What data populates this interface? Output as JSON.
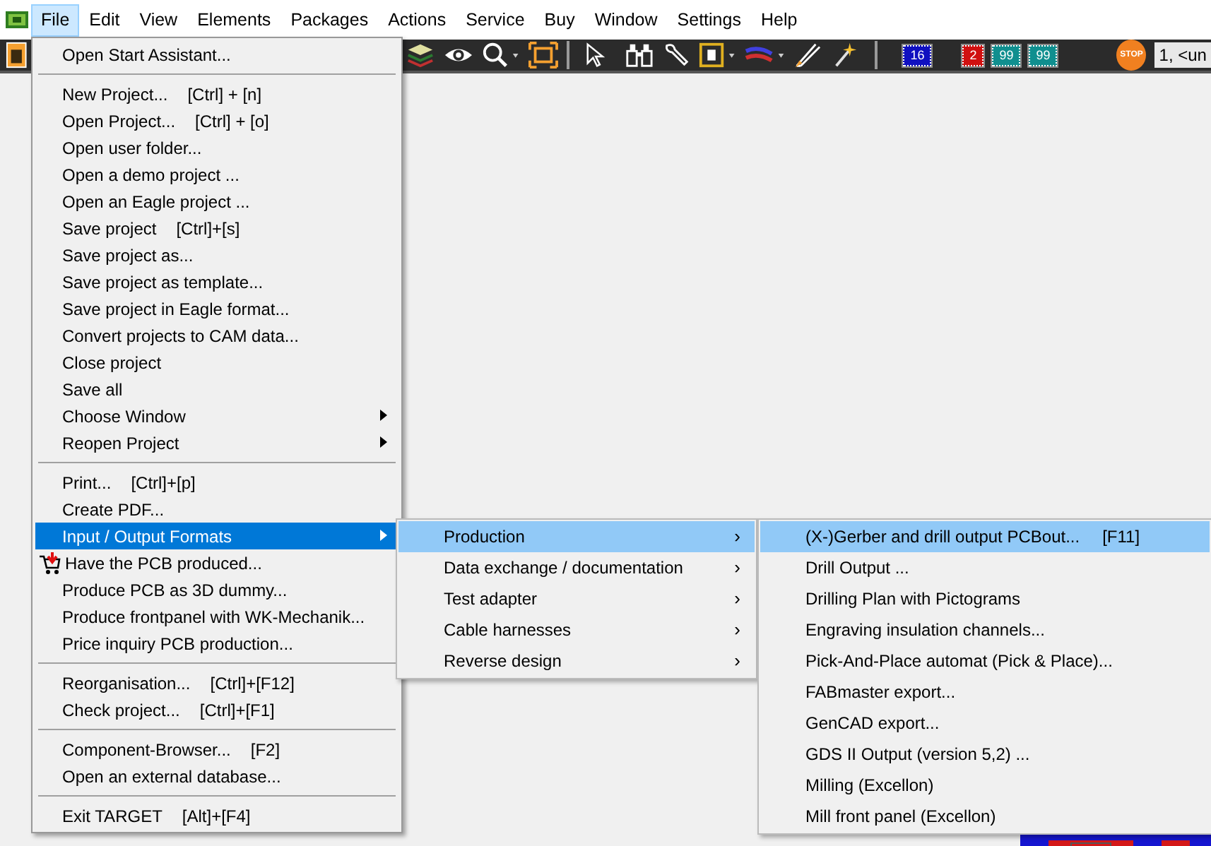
{
  "menubar": [
    {
      "label": "File",
      "selected": true
    },
    {
      "label": "Edit",
      "selected": false
    },
    {
      "label": "View",
      "selected": false
    },
    {
      "label": "Elements",
      "selected": false
    },
    {
      "label": "Packages",
      "selected": false
    },
    {
      "label": "Actions",
      "selected": false
    },
    {
      "label": "Service",
      "selected": false
    },
    {
      "label": "Buy",
      "selected": false
    },
    {
      "label": "Window",
      "selected": false
    },
    {
      "label": "Settings",
      "selected": false
    },
    {
      "label": "Help",
      "selected": false
    }
  ],
  "toolbar": {
    "badges": [
      {
        "label": "16",
        "color": "#1010c0"
      },
      {
        "label": "2",
        "color": "#d01010"
      },
      {
        "label": "99",
        "color": "#108f8f"
      },
      {
        "label": "99",
        "color": "#108f8f"
      }
    ],
    "stop_label": "STOP",
    "layer_field": "1, <un"
  },
  "file_menu": [
    {
      "kind": "item",
      "label": "Open Start Assistant...",
      "submenu": false,
      "selected": false
    },
    {
      "kind": "separator"
    },
    {
      "kind": "item",
      "label": "New Project...",
      "shortcut": "[Ctrl] + [n]",
      "submenu": false,
      "selected": false
    },
    {
      "kind": "item",
      "label": "Open Project...",
      "shortcut": "[Ctrl] + [o]",
      "submenu": false,
      "selected": false
    },
    {
      "kind": "item",
      "label": "Open user folder...",
      "submenu": false,
      "selected": false
    },
    {
      "kind": "item",
      "label": "Open a demo project ...",
      "submenu": false,
      "selected": false
    },
    {
      "kind": "item",
      "label": "Open an Eagle project ...",
      "submenu": false,
      "selected": false
    },
    {
      "kind": "item",
      "label": "Save project",
      "shortcut": "[Ctrl]+[s]",
      "submenu": false,
      "selected": false
    },
    {
      "kind": "item",
      "label": "Save project as...",
      "submenu": false,
      "selected": false
    },
    {
      "kind": "item",
      "label": "Save project as template...",
      "submenu": false,
      "selected": false
    },
    {
      "kind": "item",
      "label": "Save project in Eagle format...",
      "submenu": false,
      "selected": false
    },
    {
      "kind": "item",
      "label": "Convert projects to CAM data...",
      "submenu": false,
      "selected": false
    },
    {
      "kind": "item",
      "label": "Close project",
      "submenu": false,
      "selected": false
    },
    {
      "kind": "item",
      "label": "Save all",
      "submenu": false,
      "selected": false
    },
    {
      "kind": "item",
      "label": "Choose Window",
      "submenu": true,
      "selected": false
    },
    {
      "kind": "item",
      "label": "Reopen Project",
      "submenu": true,
      "selected": false
    },
    {
      "kind": "separator"
    },
    {
      "kind": "item",
      "label": "Print...",
      "shortcut": "[Ctrl]+[p]",
      "submenu": false,
      "selected": false
    },
    {
      "kind": "item",
      "label": "Create PDF...",
      "submenu": false,
      "selected": false
    },
    {
      "kind": "item",
      "label": "Input / Output Formats",
      "submenu": true,
      "selected": true
    },
    {
      "kind": "icon-item",
      "label": "Have the PCB produced...",
      "submenu": false,
      "selected": false
    },
    {
      "kind": "item",
      "label": "Produce PCB as 3D dummy...",
      "submenu": false,
      "selected": false
    },
    {
      "kind": "item",
      "label": "Produce frontpanel with WK-Mechanik...",
      "submenu": false,
      "selected": false
    },
    {
      "kind": "item",
      "label": "Price inquiry PCB production...",
      "submenu": false,
      "selected": false
    },
    {
      "kind": "separator"
    },
    {
      "kind": "item",
      "label": "Reorganisation...",
      "shortcut": "[Ctrl]+[F12]",
      "submenu": false,
      "selected": false
    },
    {
      "kind": "item",
      "label": "Check project...",
      "shortcut": "[Ctrl]+[F1]",
      "submenu": false,
      "selected": false
    },
    {
      "kind": "separator"
    },
    {
      "kind": "item",
      "label": "Component-Browser...",
      "shortcut": "[F2]",
      "submenu": false,
      "selected": false
    },
    {
      "kind": "item",
      "label": "Open an external database...",
      "submenu": false,
      "selected": false
    },
    {
      "kind": "separator"
    },
    {
      "kind": "item",
      "label": "Exit TARGET",
      "shortcut": "[Alt]+[F4]",
      "submenu": false,
      "selected": false
    }
  ],
  "io_submenu": [
    {
      "label": "Production",
      "arrow": "›",
      "selected": true
    },
    {
      "label": "Data exchange / documentation",
      "arrow": "›",
      "selected": false
    },
    {
      "label": "Test adapter",
      "arrow": "›",
      "selected": false
    },
    {
      "label": "Cable harnesses",
      "arrow": "›",
      "selected": false
    },
    {
      "label": "Reverse design",
      "arrow": "›",
      "selected": false
    }
  ],
  "production_submenu": [
    {
      "label": "(X-)Gerber and drill output PCBout...",
      "shortcut": "[F11]",
      "selected": true
    },
    {
      "label": "Drill Output ...",
      "selected": false
    },
    {
      "label": "Drilling Plan with Pictograms",
      "selected": false
    },
    {
      "label": "Engraving insulation channels...",
      "selected": false
    },
    {
      "label": "Pick-And-Place automat (Pick & Place)...",
      "selected": false
    },
    {
      "label": "FABmaster export...",
      "selected": false
    },
    {
      "label": "GenCAD export...",
      "selected": false
    },
    {
      "label": "GDS II Output (version 5,2) ...",
      "selected": false
    },
    {
      "label": "Milling (Excellon)",
      "selected": false
    },
    {
      "label": "Mill front panel (Excellon)",
      "selected": false
    }
  ]
}
